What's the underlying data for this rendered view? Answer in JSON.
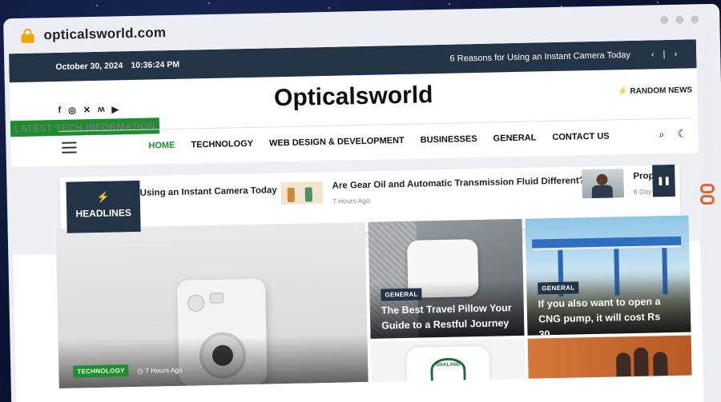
{
  "browser": {
    "url": "opticalsworld.com"
  },
  "topbar": {
    "date": "October 30, 2024",
    "time": "10:36:24 PM",
    "ticker": "6 Reasons for Using an Instant Camera Today",
    "ctrl_prev": "‹",
    "ctrl_sep": "|",
    "ctrl_next": "›"
  },
  "header": {
    "site_name": "Opticalsworld",
    "tagline": "Latest Tech Information",
    "random_news": "RANDOM NEWS",
    "social_icons": [
      "facebook-icon",
      "instagram-icon",
      "x-icon",
      "vk-icon",
      "youtube-icon"
    ]
  },
  "nav": {
    "items": [
      "HOME",
      "TECHNOLOGY",
      "WEB DESIGN & DEVELOPMENT",
      "BUSINESSES",
      "GENERAL",
      "CONTACT US"
    ],
    "active": "HOME"
  },
  "headlines": {
    "label": "HEADLINES",
    "items": [
      {
        "title": "Using an Instant Camera Today",
        "time": ""
      },
      {
        "title": "Are Gear Oil and Automatic Transmission Fluid Different?",
        "time": "7 Hours Ago"
      },
      {
        "title": "Prop",
        "time": "6 Day"
      }
    ]
  },
  "cards": {
    "main": {
      "category": "TECHNOLOGY",
      "time": "7 Hours Ago"
    },
    "pillow": {
      "category": "GENERAL",
      "title": "The Best Travel Pillow Your Guide to a Restful Journey"
    },
    "cng": {
      "category": "GENERAL",
      "title": "If you also want to open a CNG pump, it will cost Rs 30..."
    },
    "shirt": {
      "emblem_text": "OAKLAND"
    }
  },
  "colors": {
    "navy": "#243447",
    "accent_green": "#1a8f2c",
    "lock_orange": "#f0a500",
    "watermark_orange": "#e8632b"
  },
  "watermark": {
    "text": "GUESTPOSTLINKS"
  }
}
